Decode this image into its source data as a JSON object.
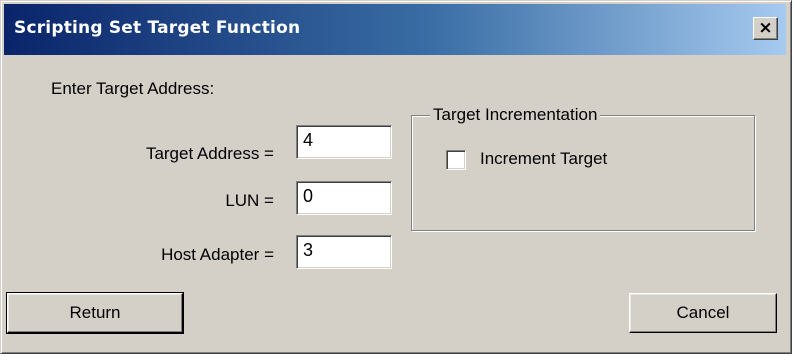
{
  "window": {
    "title": "Scripting Set Target Function",
    "close_glyph": "×"
  },
  "prompt": "Enter Target Address:",
  "fields": {
    "target_address": {
      "label": "Target Address =",
      "value": "4"
    },
    "lun": {
      "label": "LUN =",
      "value": "0"
    },
    "host_adapter": {
      "label": "Host Adapter =",
      "value": "3"
    }
  },
  "group": {
    "legend": "Target Incrementation",
    "checkbox_label": "Increment Target",
    "checked": false
  },
  "buttons": {
    "return_label": "Return",
    "cancel_label": "Cancel"
  },
  "colors": {
    "face": "#d4d0c8",
    "title_start": "#0a246a",
    "title_end": "#a6caf0"
  }
}
